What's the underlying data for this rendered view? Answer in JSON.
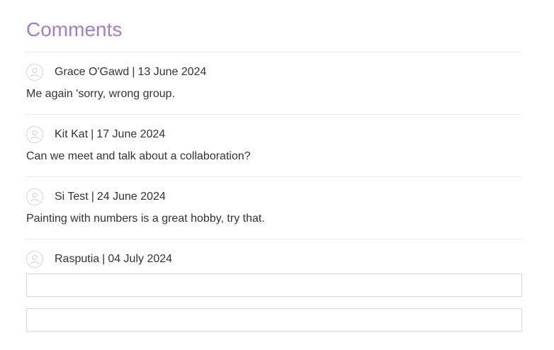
{
  "section": {
    "title": "Comments"
  },
  "comments": [
    {
      "author": "Grace O'Gawd",
      "separator": "|",
      "date": "13 June 2024",
      "text": "Me again 'sorry, wrong group."
    },
    {
      "author": "Kit Kat",
      "separator": "|",
      "date": "17 June 2024",
      "text": "Can we meet and talk about a collaboration?"
    },
    {
      "author": "Si Test",
      "separator": "|",
      "date": "24 June 2024",
      "text": "Painting with numbers is a great hobby, try that."
    }
  ],
  "compose": {
    "author": "Rasputia",
    "separator": "|",
    "date": "04 July 2024",
    "field1_value": "",
    "field2_value": ""
  },
  "icons": {
    "avatar": "user-avatar-icon"
  },
  "colors": {
    "heading": "#a67cc8",
    "text": "#333333",
    "divider": "#e8e8e8",
    "input_border": "#d9d9d9"
  }
}
